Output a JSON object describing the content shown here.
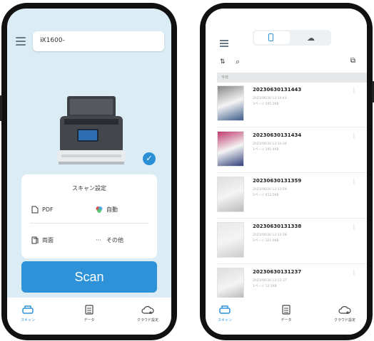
{
  "left_screen": {
    "device": {
      "name": "iX1600-",
      "chevron": "▾"
    },
    "scan_settings": {
      "title": "スキャン設定",
      "options": [
        {
          "label": "PDF",
          "icon": "document-icon"
        },
        {
          "label": "自動",
          "icon": "color-icon"
        },
        {
          "label": "両面",
          "icon": "duplex-icon"
        },
        {
          "label": "その他",
          "icon": "more-icon"
        }
      ]
    },
    "scan_button": "Scan",
    "tabs": [
      {
        "label": "スキャン",
        "icon": "scanner-icon",
        "active": true
      },
      {
        "label": "データ",
        "icon": "data-icon",
        "active": false
      },
      {
        "label": "クラウド設定",
        "icon": "cloud-settings-icon",
        "active": false
      }
    ]
  },
  "right_screen": {
    "section_label": "今日",
    "files": [
      {
        "name": "20230630131443",
        "date": "2023/06/30 13:14:43",
        "info": "3ページ 545.2KB"
      },
      {
        "name": "20230630131434",
        "date": "2023/06/30 13:14:34",
        "info": "1ページ 195.4KB"
      },
      {
        "name": "20230630131359",
        "date": "2023/06/30 13:13:59",
        "info": "2ページ 612.5KB"
      },
      {
        "name": "20230630131338",
        "date": "2023/06/30 13:13:38",
        "info": "2ページ 321.9KB"
      },
      {
        "name": "20230630131237",
        "date": "2023/06/30 13:12:37",
        "info": "1ページ 12.1KB"
      }
    ],
    "tabs": [
      {
        "label": "スキャン",
        "icon": "scanner-icon",
        "active": true
      },
      {
        "label": "データ",
        "icon": "data-icon",
        "active": false
      },
      {
        "label": "クラウド設定",
        "icon": "cloud-settings-icon",
        "active": false
      }
    ]
  },
  "colors": {
    "accent": "#2d92d8",
    "bg_left": "#dcecf5"
  }
}
